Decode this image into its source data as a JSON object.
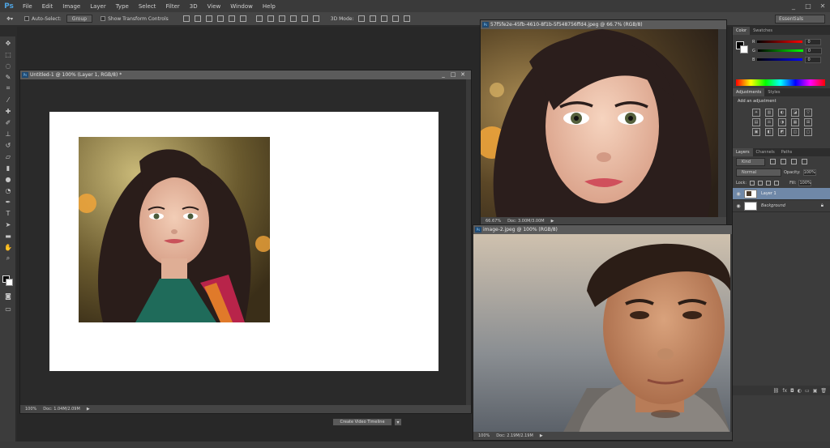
{
  "app": {
    "logo": "Ps",
    "accent": "#4fa3e0"
  },
  "menu": [
    "File",
    "Edit",
    "Image",
    "Layer",
    "Type",
    "Select",
    "Filter",
    "3D",
    "View",
    "Window",
    "Help"
  ],
  "window_controls": [
    "_",
    "□",
    "✕"
  ],
  "options": {
    "auto_select_label": "Auto-Select:",
    "group_value": "Group",
    "show_transform_label": "Show Transform Controls",
    "mode_label": "3D Mode:",
    "workspace_value": "Essentials"
  },
  "documents": {
    "main": {
      "title": "Untitled-1 @ 100% (Layer 1, RGB/8) *",
      "zoom": "100%",
      "doc_size": "Doc: 1.04M/2.09M",
      "timeline_button": "Create Video Timeline"
    },
    "woman": {
      "title": "57f5fe2e-45fb-4610-8f1b-5f548756ffd4.jpeg @ 66.7% (RGB/8)",
      "zoom": "66.67%",
      "doc_size": "Doc: 3.00M/3.00M"
    },
    "man": {
      "title": "image-2.jpeg @ 100% (RGB/8)",
      "zoom": "100%",
      "doc_size": "Doc: 2.19M/2.19M"
    }
  },
  "panels": {
    "color": {
      "tabs": [
        "Color",
        "Swatches"
      ],
      "channels": [
        {
          "label": "R",
          "value": "0",
          "color": "#d03030"
        },
        {
          "label": "G",
          "value": "0",
          "color": "#30b030"
        },
        {
          "label": "B",
          "value": "0",
          "color": "#3060d0"
        }
      ]
    },
    "adjustments": {
      "tabs": [
        "Adjustments",
        "Styles"
      ],
      "heading": "Add an adjustment",
      "icons": [
        "☀",
        "▥",
        "◐",
        "◪",
        "▽",
        "",
        "▤",
        "⚖",
        "◑",
        "▦",
        "⊞",
        "",
        "▣",
        "◧",
        "◩",
        "◫",
        "▢"
      ]
    },
    "layers": {
      "tabs": [
        "Layers",
        "Channels",
        "Paths"
      ],
      "filter": "Kind",
      "blend_mode": "Normal",
      "opacity_label": "Opacity:",
      "opacity_value": "100%",
      "lock_label": "Lock:",
      "fill_label": "Fill:",
      "fill_value": "100%",
      "items": [
        {
          "name": "Layer 1",
          "selected": true
        },
        {
          "name": "Background",
          "selected": false
        }
      ]
    }
  }
}
